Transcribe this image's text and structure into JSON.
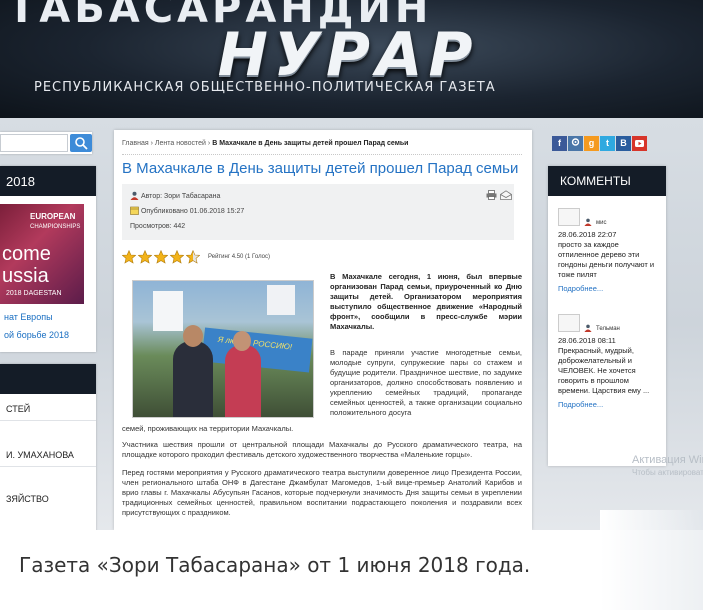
{
  "banner": {
    "top_line": "ТАБАСАРАНДИН",
    "main_title": "НУРАР",
    "subtitle": "РЕСПУБЛИКАНСКАЯ ОБЩЕСТВЕННО-ПОЛИТИЧЕСКАЯ ГАЗЕТА"
  },
  "left": {
    "search_placeholder": "",
    "promo_year": "2018",
    "promo_img": {
      "line1": "EUROPEAN",
      "line2": "CHAMPIONSHIPS",
      "come": "come",
      "russia": "ussia",
      "dag": "2018  DAGESTAN"
    },
    "promo_link1": "нат Европы",
    "promo_link2": "ой борьбе 2018",
    "menu_items": [
      "СТЕЙ",
      "И. УМАХАНОВА",
      "ЗЯЙСТВО"
    ]
  },
  "article": {
    "breadcrumbs": {
      "home": "Главная",
      "sep": "›",
      "news": "Лента новостей",
      "current": "В Махачкале в День защиты детей прошел Парад семьи"
    },
    "title": "В Махачкале в День защиты детей прошел Парад семьи",
    "author": "Автор: Зори Табасарана",
    "published": "Опубликовано 01.06.2018 15:27",
    "views": "Просмотров: 442",
    "rating_value": 4.5,
    "rating_max": 5,
    "rating_text": "Рейтинг 4.50 (1 Голос)",
    "photo_banner_text": "Я люблю РОССИЮ!",
    "intro": "В Махачкале сегодня, 1 июня, был впервые организован Парад семьи, приуроченный ко Дню защиты детей. Организатором мероприятия выступило общественное движение «Народный фронт», сообщили в пресс-службе мэрии Махачкалы.",
    "p2": "В параде приняли участие многодетные семьи, молодые супруги, супружеские пары со стажем и будущие родители. Праздничное шествие, по задумке организаторов, должно способствовать появлению и укреплению семейных традиций, пропаганде семейных ценностей, а также организации социально положительного досуга",
    "p2_tail": "семей, проживающих на территории Махачкалы.",
    "p3": "Участника шествия прошли от центральной площади Махачкалы до Русского драматического театра, на площадке которого проходил фестиваль детского художественного творчества «Маленькие горцы».",
    "p4": "Перед гостями мероприятия у Русского драматического театра выступили доверенное лицо Президента России, член регионального штаба ОНФ в Дагестане Джамбулат Магомедов, 1-ый вице-премьер Анатолий Карибов и врио главы г. Махачкалы Абусупьян Гасанов, которые подчеркнули значимость Дня защиты семьи в укреплении традиционных семейных ценностей, правильном воспитании подрастающего поколения и поздравили всех присутствующих с праздником."
  },
  "social": [
    "f",
    "ok",
    "g",
    "t",
    "B",
    "yt"
  ],
  "comments": {
    "heading": "КОММЕНТЫ",
    "items": [
      {
        "name": "мис",
        "date": "28.06.2018 22:07",
        "text": "просто за каждое отпиленное дерево эти гондоны деньги получают и тоже пилят",
        "more": "Подробнее..."
      },
      {
        "name": "Тельман",
        "date": "28.06.2018 08:11",
        "text": "Прекрасный, мудрый, доброжелательный и ЧЕЛОВЕК. Не хочется говорить в прошлом времени. Царствия ему ...",
        "more": "Подробнее..."
      }
    ]
  },
  "activation": {
    "line1": "Активация Windo",
    "line2": "Чтобы активировать W компьютера."
  },
  "caption": "Газета «Зори Табасарана» от 1 июня 2018 года.",
  "colors": {
    "title_blue": "#2573c4",
    "dark_header": "#141c27",
    "search_blue": "#3d8bd8"
  }
}
